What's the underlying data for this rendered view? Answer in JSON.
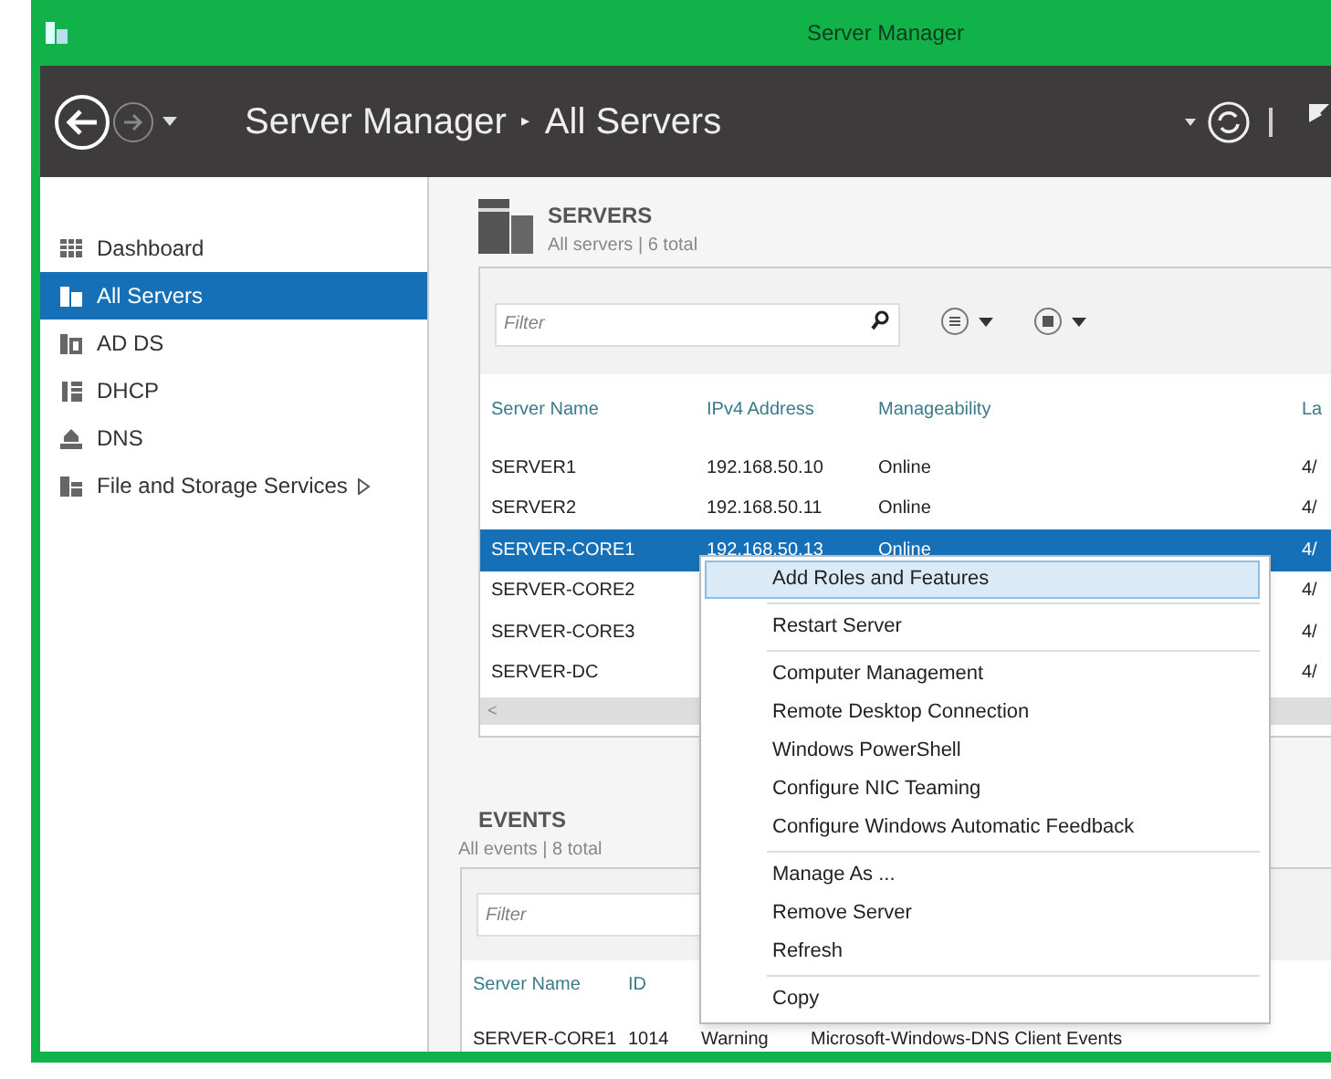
{
  "window": {
    "title": "Server Manager"
  },
  "breadcrumb": {
    "root": "Server Manager",
    "separator": "▸",
    "current": "All Servers"
  },
  "sidebar": {
    "items": [
      {
        "label": "Dashboard",
        "selected": false,
        "submenu": false
      },
      {
        "label": "All Servers",
        "selected": true,
        "submenu": false
      },
      {
        "label": "AD DS",
        "selected": false,
        "submenu": false
      },
      {
        "label": "DHCP",
        "selected": false,
        "submenu": false
      },
      {
        "label": "DNS",
        "selected": false,
        "submenu": false
      },
      {
        "label": "File and Storage Services",
        "selected": false,
        "submenu": true
      }
    ]
  },
  "servers": {
    "title": "SERVERS",
    "subtitle": "All servers | 6 total",
    "filter": {
      "placeholder": "Filter"
    },
    "columns": [
      "Server Name",
      "IPv4 Address",
      "Manageability",
      "La"
    ],
    "rows": [
      {
        "cells": [
          "SERVER1",
          "192.168.50.10",
          "Online",
          "4/"
        ],
        "selected": false
      },
      {
        "cells": [
          "SERVER2",
          "192.168.50.11",
          "Online",
          "4/"
        ],
        "selected": false
      },
      {
        "cells": [
          "SERVER-CORE1",
          "192.168.50.13",
          "Online",
          "4/"
        ],
        "selected": true
      },
      {
        "cells": [
          "SERVER-CORE2",
          "",
          "",
          "4/"
        ],
        "selected": false
      },
      {
        "cells": [
          "SERVER-CORE3",
          "",
          "",
          "4/"
        ],
        "selected": false
      },
      {
        "cells": [
          "SERVER-DC",
          "",
          "",
          "4/"
        ],
        "selected": false
      }
    ],
    "scroll_left": "<"
  },
  "events": {
    "title": "EVENTS",
    "subtitle": "All events | 8 total",
    "filter": {
      "placeholder": "Filter"
    },
    "columns": [
      "Server Name",
      "ID"
    ],
    "rows": [
      {
        "cells": [
          "SERVER-CORE1",
          "1014",
          "Warning",
          "Microsoft-Windows-DNS Client Events"
        ]
      }
    ]
  },
  "context_menu": {
    "items": [
      {
        "kind": "item",
        "label": "Add Roles and Features",
        "selected": true
      },
      {
        "kind": "separator"
      },
      {
        "kind": "item",
        "label": "Restart Server",
        "selected": false
      },
      {
        "kind": "separator"
      },
      {
        "kind": "item",
        "label": "Computer Management",
        "selected": false
      },
      {
        "kind": "item",
        "label": "Remote Desktop Connection",
        "selected": false
      },
      {
        "kind": "item",
        "label": "Windows PowerShell",
        "selected": false
      },
      {
        "kind": "item",
        "label": "Configure NIC Teaming",
        "selected": false
      },
      {
        "kind": "item",
        "label": "Configure Windows Automatic Feedback",
        "selected": false
      },
      {
        "kind": "separator"
      },
      {
        "kind": "item",
        "label": "Manage As ...",
        "selected": false
      },
      {
        "kind": "item",
        "label": "Remove Server",
        "selected": false
      },
      {
        "kind": "item",
        "label": "Refresh",
        "selected": false
      },
      {
        "kind": "separator"
      },
      {
        "kind": "item",
        "label": "Copy",
        "selected": false
      }
    ]
  }
}
